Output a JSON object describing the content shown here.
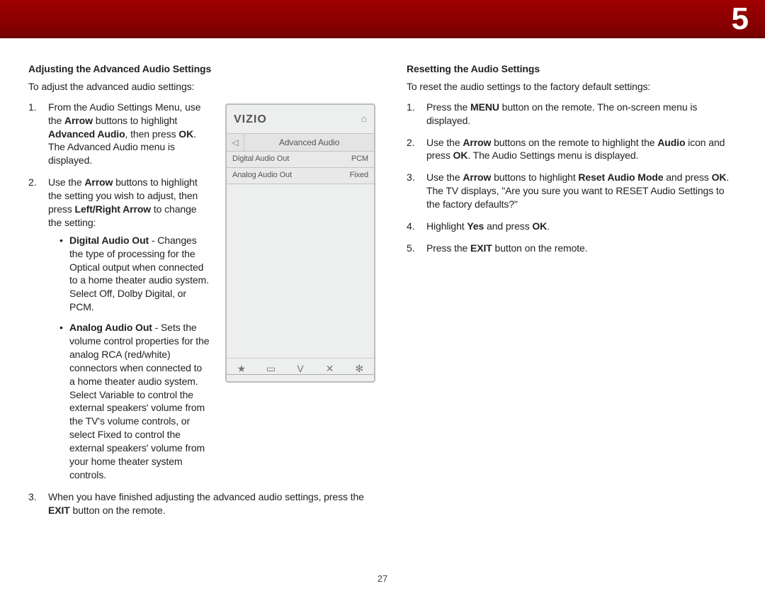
{
  "chapter_number": "5",
  "page_number": "27",
  "left": {
    "title": "Adjusting the Advanced Audio Settings",
    "intro": "To adjust the advanced audio settings:",
    "step1": {
      "pre": "From the Audio Settings Menu, use the ",
      "arrow": "Arrow",
      "mid1": " buttons to highlight ",
      "aa": "Advanced Audio",
      "mid2": ", then press ",
      "ok": "OK",
      "post": ". The Advanced Audio menu is displayed."
    },
    "step2": {
      "pre": "Use the ",
      "arrow": "Arrow",
      "mid1": " buttons to highlight the setting you wish to adjust, then press ",
      "lr": "Left/Right Arrow",
      "post": " to change the setting:"
    },
    "dao": {
      "name": "Digital Audio Out",
      "desc": " - Changes the type of processing for the Optical output when connected to a home theater audio system. Select Off, Dolby Digital, or PCM."
    },
    "aao": {
      "name": "Analog Audio Out",
      "desc": " - Sets the volume control properties for the analog RCA (red/white) connectors when connected to a home theater audio system. Select Variable to control the external speakers' volume from the TV's volume controls, or select Fixed to control the external speakers' volume from your home theater system controls."
    },
    "step3": {
      "pre": "When you have finished adjusting the advanced audio settings, press the ",
      "exit": "EXIT",
      "post": " button on the remote."
    }
  },
  "osd": {
    "brand": "VIZIO",
    "home_icon": "⌂",
    "back_icon": "◁",
    "header_title": "Advanced Audio",
    "row1": {
      "label": "Digital Audio Out",
      "value": "PCM"
    },
    "row2": {
      "label": "Analog Audio Out",
      "value": "Fixed"
    },
    "bottom_icons": {
      "star": "★",
      "wide": "▭",
      "v": "V",
      "x": "✕",
      "gear": "✻"
    }
  },
  "right": {
    "title": "Resetting the Audio Settings",
    "intro": "To reset the audio settings to the factory default settings:",
    "s1": {
      "pre": "Press the ",
      "menu": "MENU",
      "post": " button on the remote. The on-screen menu is displayed."
    },
    "s2": {
      "pre": "Use the ",
      "arrow": "Arrow",
      "mid1": " buttons on the remote to highlight the ",
      "audio": "Audio",
      "mid2": " icon and press ",
      "ok": "OK",
      "post": ". The Audio Settings menu is displayed."
    },
    "s3": {
      "pre": "Use the ",
      "arrow": "Arrow",
      "mid1": " buttons to highlight ",
      "ram": "Reset Audio Mode",
      "mid2": " and press ",
      "ok": "OK",
      "post": ". The TV displays, \"Are you sure you want to RESET Audio Settings to the factory defaults?\""
    },
    "s4": {
      "pre": "Highlight ",
      "yes": "Yes",
      "mid": " and press ",
      "ok": "OK",
      "post": "."
    },
    "s5": {
      "pre": "Press the ",
      "exit": "EXIT",
      "post": " button on the remote."
    }
  }
}
